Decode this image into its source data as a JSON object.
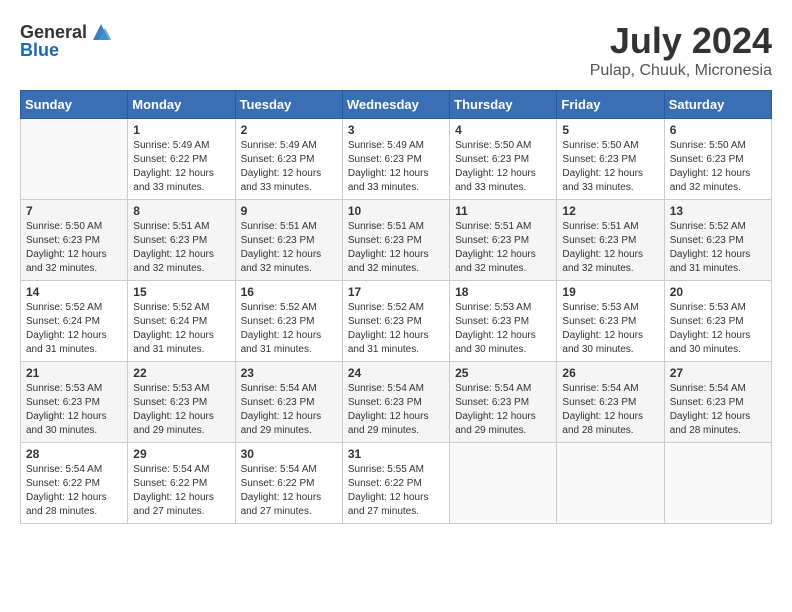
{
  "header": {
    "logo_general": "General",
    "logo_blue": "Blue",
    "month_year": "July 2024",
    "location": "Pulap, Chuuk, Micronesia"
  },
  "days_of_week": [
    "Sunday",
    "Monday",
    "Tuesday",
    "Wednesday",
    "Thursday",
    "Friday",
    "Saturday"
  ],
  "weeks": [
    [
      {
        "day": "",
        "info": ""
      },
      {
        "day": "1",
        "info": "Sunrise: 5:49 AM\nSunset: 6:22 PM\nDaylight: 12 hours\nand 33 minutes."
      },
      {
        "day": "2",
        "info": "Sunrise: 5:49 AM\nSunset: 6:23 PM\nDaylight: 12 hours\nand 33 minutes."
      },
      {
        "day": "3",
        "info": "Sunrise: 5:49 AM\nSunset: 6:23 PM\nDaylight: 12 hours\nand 33 minutes."
      },
      {
        "day": "4",
        "info": "Sunrise: 5:50 AM\nSunset: 6:23 PM\nDaylight: 12 hours\nand 33 minutes."
      },
      {
        "day": "5",
        "info": "Sunrise: 5:50 AM\nSunset: 6:23 PM\nDaylight: 12 hours\nand 33 minutes."
      },
      {
        "day": "6",
        "info": "Sunrise: 5:50 AM\nSunset: 6:23 PM\nDaylight: 12 hours\nand 32 minutes."
      }
    ],
    [
      {
        "day": "7",
        "info": "Sunrise: 5:50 AM\nSunset: 6:23 PM\nDaylight: 12 hours\nand 32 minutes."
      },
      {
        "day": "8",
        "info": "Sunrise: 5:51 AM\nSunset: 6:23 PM\nDaylight: 12 hours\nand 32 minutes."
      },
      {
        "day": "9",
        "info": "Sunrise: 5:51 AM\nSunset: 6:23 PM\nDaylight: 12 hours\nand 32 minutes."
      },
      {
        "day": "10",
        "info": "Sunrise: 5:51 AM\nSunset: 6:23 PM\nDaylight: 12 hours\nand 32 minutes."
      },
      {
        "day": "11",
        "info": "Sunrise: 5:51 AM\nSunset: 6:23 PM\nDaylight: 12 hours\nand 32 minutes."
      },
      {
        "day": "12",
        "info": "Sunrise: 5:51 AM\nSunset: 6:23 PM\nDaylight: 12 hours\nand 32 minutes."
      },
      {
        "day": "13",
        "info": "Sunrise: 5:52 AM\nSunset: 6:23 PM\nDaylight: 12 hours\nand 31 minutes."
      }
    ],
    [
      {
        "day": "14",
        "info": "Sunrise: 5:52 AM\nSunset: 6:24 PM\nDaylight: 12 hours\nand 31 minutes."
      },
      {
        "day": "15",
        "info": "Sunrise: 5:52 AM\nSunset: 6:24 PM\nDaylight: 12 hours\nand 31 minutes."
      },
      {
        "day": "16",
        "info": "Sunrise: 5:52 AM\nSunset: 6:23 PM\nDaylight: 12 hours\nand 31 minutes."
      },
      {
        "day": "17",
        "info": "Sunrise: 5:52 AM\nSunset: 6:23 PM\nDaylight: 12 hours\nand 31 minutes."
      },
      {
        "day": "18",
        "info": "Sunrise: 5:53 AM\nSunset: 6:23 PM\nDaylight: 12 hours\nand 30 minutes."
      },
      {
        "day": "19",
        "info": "Sunrise: 5:53 AM\nSunset: 6:23 PM\nDaylight: 12 hours\nand 30 minutes."
      },
      {
        "day": "20",
        "info": "Sunrise: 5:53 AM\nSunset: 6:23 PM\nDaylight: 12 hours\nand 30 minutes."
      }
    ],
    [
      {
        "day": "21",
        "info": "Sunrise: 5:53 AM\nSunset: 6:23 PM\nDaylight: 12 hours\nand 30 minutes."
      },
      {
        "day": "22",
        "info": "Sunrise: 5:53 AM\nSunset: 6:23 PM\nDaylight: 12 hours\nand 29 minutes."
      },
      {
        "day": "23",
        "info": "Sunrise: 5:54 AM\nSunset: 6:23 PM\nDaylight: 12 hours\nand 29 minutes."
      },
      {
        "day": "24",
        "info": "Sunrise: 5:54 AM\nSunset: 6:23 PM\nDaylight: 12 hours\nand 29 minutes."
      },
      {
        "day": "25",
        "info": "Sunrise: 5:54 AM\nSunset: 6:23 PM\nDaylight: 12 hours\nand 29 minutes."
      },
      {
        "day": "26",
        "info": "Sunrise: 5:54 AM\nSunset: 6:23 PM\nDaylight: 12 hours\nand 28 minutes."
      },
      {
        "day": "27",
        "info": "Sunrise: 5:54 AM\nSunset: 6:23 PM\nDaylight: 12 hours\nand 28 minutes."
      }
    ],
    [
      {
        "day": "28",
        "info": "Sunrise: 5:54 AM\nSunset: 6:22 PM\nDaylight: 12 hours\nand 28 minutes."
      },
      {
        "day": "29",
        "info": "Sunrise: 5:54 AM\nSunset: 6:22 PM\nDaylight: 12 hours\nand 27 minutes."
      },
      {
        "day": "30",
        "info": "Sunrise: 5:54 AM\nSunset: 6:22 PM\nDaylight: 12 hours\nand 27 minutes."
      },
      {
        "day": "31",
        "info": "Sunrise: 5:55 AM\nSunset: 6:22 PM\nDaylight: 12 hours\nand 27 minutes."
      },
      {
        "day": "",
        "info": ""
      },
      {
        "day": "",
        "info": ""
      },
      {
        "day": "",
        "info": ""
      }
    ]
  ]
}
